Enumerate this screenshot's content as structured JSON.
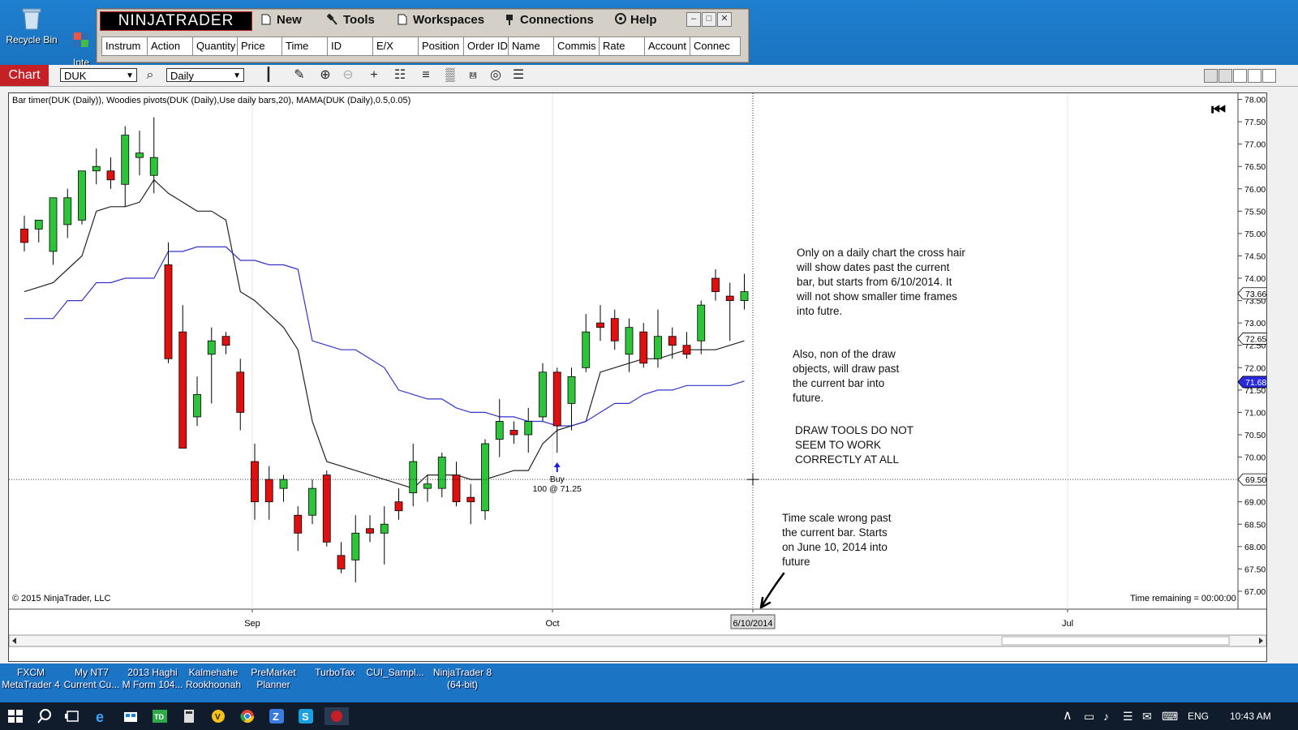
{
  "desktop": {
    "icons": [
      {
        "label": "Recycle Bin"
      },
      {
        "label": "Inte\nBrov"
      }
    ]
  },
  "control_center": {
    "logo": "NINJATRADER",
    "menu": [
      {
        "label": "New",
        "icon": "new-icon"
      },
      {
        "label": "Tools",
        "icon": "tools-icon"
      },
      {
        "label": "Workspaces",
        "icon": "workspaces-icon"
      },
      {
        "label": "Connections",
        "icon": "connections-icon"
      },
      {
        "label": "Help",
        "icon": "help-icon"
      }
    ],
    "columns": [
      "Instrum",
      "Action",
      "Quantity",
      "Price",
      "Time",
      "ID",
      "E/X",
      "Position",
      "Order ID",
      "Name",
      "Commis",
      "Rate",
      "Account",
      "Connec"
    ]
  },
  "chart_window": {
    "tab": "Chart",
    "instrument": "DUK",
    "period": "Daily",
    "indicators_label": "Bar timer(DUK (Daily)), Woodies pivots(DUK (Daily),Use daily bars,20), MAMA(DUK (Daily),0.5,0.05)",
    "copyright": "© 2015 NinjaTrader, LLC",
    "time_remaining": "Time remaining = 00:00:00",
    "crosshair_date": "6/10/2014",
    "buy_label": "Buy",
    "buy_detail": "100 @ 71.25",
    "price_badges": [
      {
        "value": "73.66",
        "color": "#ffffff"
      },
      {
        "value": "72.65",
        "color": "#ffffff"
      },
      {
        "value": "71.68",
        "color": "#2a2ae0"
      },
      {
        "value": "69.50",
        "color": "#ffffff"
      }
    ],
    "notes": [
      "Only on a daily chart the cross hair\nwill show dates past the current\nbar, but starts from 6/10/2014. It\nwill not show smaller time frames\ninto futre.",
      "Also, non of the draw\nobjects, will draw past\nthe current bar into\nfuture.",
      "DRAW TOOLS DO NOT\nSEEM TO WORK\nCORRECTLY AT ALL",
      "Time scale wrong past\nthe current bar. Starts\non June 10, 2014 into\nfuture"
    ]
  },
  "chart_data": {
    "type": "candlestick",
    "x_ticks": [
      "Sep",
      "Oct",
      "6/10/2014",
      "Jul"
    ],
    "y_ticks": [
      "78.00",
      "77.50",
      "77.00",
      "76.50",
      "76.00",
      "75.50",
      "75.00",
      "74.50",
      "74.00",
      "73.50",
      "73.00",
      "72.50",
      "72.00",
      "71.50",
      "71.00",
      "70.50",
      "70.00",
      "69.50",
      "69.00",
      "68.50",
      "68.00",
      "67.50",
      "67.00"
    ],
    "ylim": [
      66.6,
      78.1
    ],
    "candles": [
      {
        "o": 75.1,
        "h": 75.4,
        "l": 74.6,
        "c": 74.8
      },
      {
        "o": 75.1,
        "h": 75.3,
        "l": 74.8,
        "c": 75.3
      },
      {
        "o": 74.6,
        "h": 75.7,
        "l": 74.3,
        "c": 75.8
      },
      {
        "o": 75.2,
        "h": 76.0,
        "l": 74.9,
        "c": 75.8
      },
      {
        "o": 75.3,
        "h": 76.1,
        "l": 75.2,
        "c": 76.4
      },
      {
        "o": 76.4,
        "h": 76.9,
        "l": 76.1,
        "c": 76.5
      },
      {
        "o": 76.4,
        "h": 76.7,
        "l": 76.0,
        "c": 76.2
      },
      {
        "o": 76.1,
        "h": 77.4,
        "l": 75.6,
        "c": 77.2
      },
      {
        "o": 76.7,
        "h": 77.3,
        "l": 76.3,
        "c": 76.8
      },
      {
        "o": 76.3,
        "h": 77.6,
        "l": 75.9,
        "c": 76.7
      },
      {
        "o": 74.3,
        "h": 74.8,
        "l": 72.1,
        "c": 72.2
      },
      {
        "o": 72.8,
        "h": 73.4,
        "l": 70.2,
        "c": 70.2
      },
      {
        "o": 70.9,
        "h": 71.8,
        "l": 70.7,
        "c": 71.4
      },
      {
        "o": 72.3,
        "h": 72.9,
        "l": 71.2,
        "c": 72.6
      },
      {
        "o": 72.7,
        "h": 72.8,
        "l": 72.3,
        "c": 72.5
      },
      {
        "o": 71.9,
        "h": 72.2,
        "l": 70.6,
        "c": 71.0
      },
      {
        "o": 69.9,
        "h": 70.3,
        "l": 68.6,
        "c": 69.0
      },
      {
        "o": 69.5,
        "h": 69.8,
        "l": 68.6,
        "c": 69.0
      },
      {
        "o": 69.3,
        "h": 69.6,
        "l": 69.0,
        "c": 69.5
      },
      {
        "o": 68.7,
        "h": 68.9,
        "l": 67.9,
        "c": 68.3
      },
      {
        "o": 68.7,
        "h": 69.5,
        "l": 68.5,
        "c": 69.3
      },
      {
        "o": 69.6,
        "h": 69.7,
        "l": 68.0,
        "c": 68.1
      },
      {
        "o": 67.8,
        "h": 68.1,
        "l": 67.4,
        "c": 67.5
      },
      {
        "o": 67.7,
        "h": 68.7,
        "l": 67.2,
        "c": 68.3
      },
      {
        "o": 68.4,
        "h": 68.7,
        "l": 68.1,
        "c": 68.3
      },
      {
        "o": 68.3,
        "h": 68.9,
        "l": 67.6,
        "c": 68.5
      },
      {
        "o": 69.0,
        "h": 69.3,
        "l": 68.6,
        "c": 68.8
      },
      {
        "o": 69.2,
        "h": 70.3,
        "l": 68.9,
        "c": 69.9
      },
      {
        "o": 69.3,
        "h": 69.6,
        "l": 69.0,
        "c": 69.4
      },
      {
        "o": 69.3,
        "h": 70.1,
        "l": 69.1,
        "c": 70.0
      },
      {
        "o": 69.6,
        "h": 69.9,
        "l": 68.9,
        "c": 69.0
      },
      {
        "o": 69.1,
        "h": 69.4,
        "l": 68.5,
        "c": 69.0
      },
      {
        "o": 68.8,
        "h": 70.4,
        "l": 68.6,
        "c": 70.3
      },
      {
        "o": 70.4,
        "h": 71.3,
        "l": 70.0,
        "c": 70.8
      },
      {
        "o": 70.6,
        "h": 70.8,
        "l": 70.3,
        "c": 70.5
      },
      {
        "o": 70.5,
        "h": 71.1,
        "l": 70.1,
        "c": 70.8
      },
      {
        "o": 70.9,
        "h": 72.1,
        "l": 70.8,
        "c": 71.9
      },
      {
        "o": 71.9,
        "h": 72.0,
        "l": 70.1,
        "c": 70.7
      },
      {
        "o": 71.2,
        "h": 72.0,
        "l": 70.6,
        "c": 71.8
      },
      {
        "o": 72.0,
        "h": 73.2,
        "l": 71.9,
        "c": 72.8
      },
      {
        "o": 73.0,
        "h": 73.4,
        "l": 72.6,
        "c": 72.9
      },
      {
        "o": 73.1,
        "h": 73.3,
        "l": 72.4,
        "c": 72.6
      },
      {
        "o": 72.3,
        "h": 73.1,
        "l": 71.9,
        "c": 72.9
      },
      {
        "o": 72.8,
        "h": 73.0,
        "l": 72.0,
        "c": 72.1
      },
      {
        "o": 72.2,
        "h": 73.3,
        "l": 72.0,
        "c": 72.7
      },
      {
        "o": 72.7,
        "h": 72.9,
        "l": 72.2,
        "c": 72.5
      },
      {
        "o": 72.5,
        "h": 72.8,
        "l": 72.2,
        "c": 72.3
      },
      {
        "o": 72.6,
        "h": 73.5,
        "l": 72.3,
        "c": 73.4
      },
      {
        "o": 74.0,
        "h": 74.2,
        "l": 73.5,
        "c": 73.7
      },
      {
        "o": 73.6,
        "h": 73.9,
        "l": 72.6,
        "c": 73.5
      },
      {
        "o": 73.5,
        "h": 74.1,
        "l": 73.3,
        "c": 73.7
      }
    ],
    "series": [
      {
        "color": "#222222",
        "values": [
          73.7,
          73.8,
          73.9,
          74.2,
          74.5,
          75.5,
          75.6,
          75.6,
          75.7,
          76.2,
          75.9,
          75.7,
          75.5,
          75.5,
          75.3,
          73.7,
          73.5,
          73.2,
          72.9,
          72.4,
          70.8,
          69.9,
          69.8,
          69.7,
          69.6,
          69.5,
          69.4,
          69.3,
          69.6,
          69.6,
          69.6,
          69.5,
          69.5,
          69.6,
          69.7,
          69.7,
          70.3,
          70.6,
          70.7,
          70.8,
          71.9,
          72.0,
          72.1,
          72.2,
          72.2,
          72.3,
          72.4,
          72.4,
          72.4,
          72.5,
          72.6
        ]
      },
      {
        "color": "#3333cc",
        "values": [
          73.1,
          73.1,
          73.1,
          73.5,
          73.5,
          73.9,
          73.9,
          74.0,
          74.0,
          74.0,
          74.6,
          74.6,
          74.7,
          74.7,
          74.7,
          74.4,
          74.4,
          74.3,
          74.3,
          74.2,
          72.6,
          72.5,
          72.4,
          72.4,
          72.2,
          72.0,
          71.5,
          71.4,
          71.3,
          71.3,
          71.1,
          71.0,
          71.0,
          70.9,
          70.9,
          70.8,
          70.8,
          70.7,
          70.7,
          70.8,
          71.0,
          71.2,
          71.2,
          71.4,
          71.5,
          71.5,
          71.6,
          71.6,
          71.6,
          71.6,
          71.7
        ]
      }
    ],
    "buy_marker_index": 37,
    "crosshair_price": 69.5
  },
  "launchers": [
    {
      "label": "FXCM\nMetaTrader 4"
    },
    {
      "label": "My NT7\nCurrent Cu..."
    },
    {
      "label": "2013 Haghi\nM Form 104..."
    },
    {
      "label": "Kalmehahe\nRookhoonah"
    },
    {
      "label": "PreMarket\nPlanner"
    },
    {
      "label": "TurboTax"
    },
    {
      "label": "CUI_Sampl..."
    },
    {
      "label": "NinjaTrader 8\n(64-bit)"
    }
  ],
  "taskbar": {
    "language": "ENG",
    "clock": "10:43 AM"
  }
}
